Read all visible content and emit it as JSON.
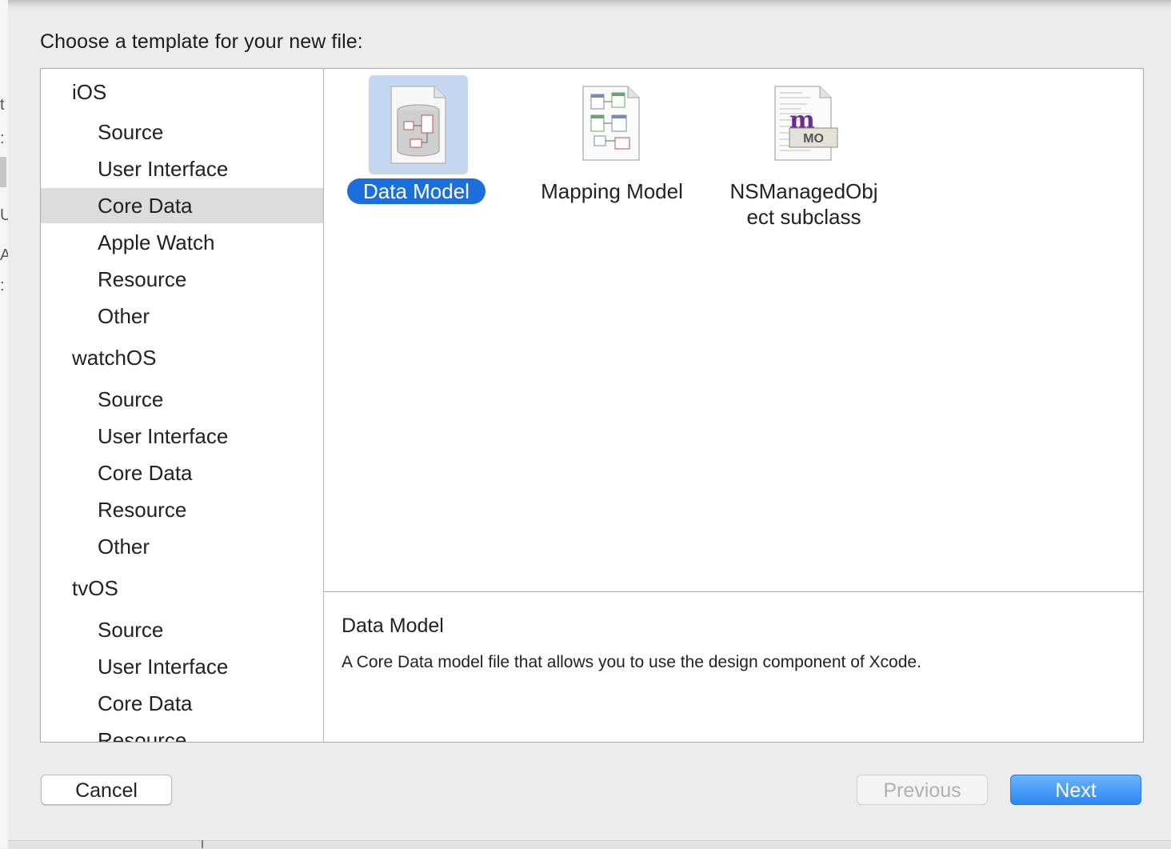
{
  "dialog": {
    "title": "Choose a template for your new file:"
  },
  "background_fragments": [
    "t",
    ":",
    "U",
    "A",
    ":"
  ],
  "sidebar": {
    "groups": [
      {
        "platform": "iOS",
        "items": [
          "Source",
          "User Interface",
          "Core Data",
          "Apple Watch",
          "Resource",
          "Other"
        ]
      },
      {
        "platform": "watchOS",
        "items": [
          "Source",
          "User Interface",
          "Core Data",
          "Resource",
          "Other"
        ]
      },
      {
        "platform": "tvOS",
        "items": [
          "Source",
          "User Interface",
          "Core Data",
          "Resource"
        ]
      }
    ],
    "selected": "iOS / Core Data"
  },
  "templates": [
    {
      "label": "Data Model",
      "icon": "data-model-icon",
      "selected": true
    },
    {
      "label": "Mapping Model",
      "icon": "mapping-model-icon",
      "selected": false
    },
    {
      "label_line1": "NSManagedObj",
      "label_line2": "ect subclass",
      "icon": "nsmanagedobject-icon",
      "badge": "MO",
      "badge_letter": "m",
      "selected": false
    }
  ],
  "description": {
    "title": "Data Model",
    "text": "A Core Data model file that allows you to use the design component of Xcode."
  },
  "buttons": {
    "cancel": "Cancel",
    "previous": "Previous",
    "next": "Next",
    "previous_enabled": false
  },
  "colors": {
    "accent": "#1a6fdd",
    "selection_highlight": "#c3d8f0",
    "sidebar_selected": "#dcdcdc",
    "mo_purple": "#6a2c91"
  }
}
